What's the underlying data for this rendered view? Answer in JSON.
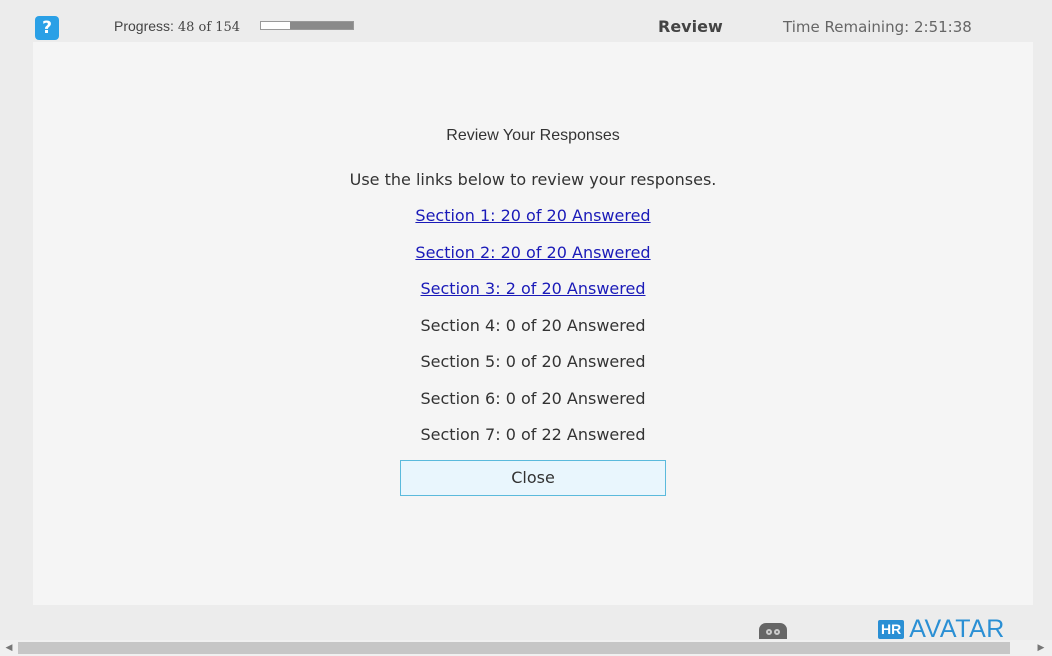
{
  "header": {
    "help_icon": "?",
    "progress_label": "Progress:",
    "progress_value": "48 of 154",
    "progress_fraction": 0.687,
    "title": "Review",
    "time_label": "Time Remaining:",
    "time_value": "2:51:38"
  },
  "review": {
    "heading": "Review Your Responses",
    "instructions": "Use the links below to review your responses.",
    "sections": [
      {
        "label": "Section 1: 20 of 20 Answered",
        "link": true
      },
      {
        "label": "Section 2: 20 of 20 Answered",
        "link": true
      },
      {
        "label": "Section 3: 2 of 20 Answered",
        "link": true
      },
      {
        "label": "Section 4: 0 of 20 Answered",
        "link": false
      },
      {
        "label": "Section 5: 0 of 20 Answered",
        "link": false
      },
      {
        "label": "Section 6: 0 of 20 Answered",
        "link": false
      },
      {
        "label": "Section 7: 0 of 22 Answered",
        "link": false
      }
    ],
    "close_label": "Close"
  },
  "footer": {
    "logo_mark": "HR",
    "logo_text": "AVATAR",
    "logo_tm": "™"
  },
  "colors": {
    "accent": "#2a8fd4",
    "link": "#1a1ab8",
    "close_bg": "#e9f6fd",
    "close_border": "#5bbadc"
  },
  "icons": {
    "help": "help-icon",
    "accessibility": "accessibility-icon"
  }
}
